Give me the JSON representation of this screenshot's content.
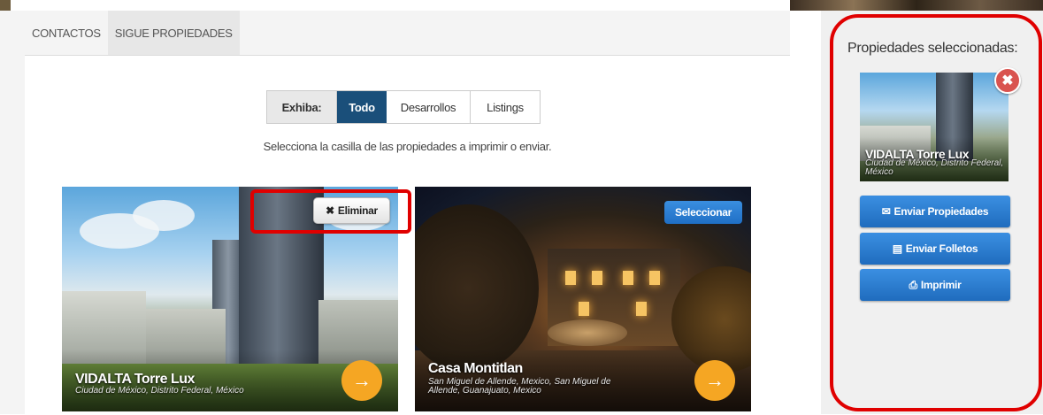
{
  "tabs": [
    {
      "label": "CONTACTOS"
    },
    {
      "label": "SIGUE PROPIEDADES"
    }
  ],
  "filter": {
    "label": "Exhiba:",
    "options": [
      {
        "label": "Todo",
        "selected": true
      },
      {
        "label": "Desarrollos",
        "selected": false
      },
      {
        "label": "Listings",
        "selected": false
      }
    ]
  },
  "instructions": "Selecciona la casilla de las propiedades a imprimir o enviar.",
  "properties": [
    {
      "title": "VIDALTA Torre Lux",
      "location": "Ciudad de México, Distrito Federal, México",
      "action_label": "Eliminar",
      "action_icon": "close-icon"
    },
    {
      "title": "Casa Montitlan",
      "location": "San Miguel de Allende, Mexico, San Miguel de Allende, Guanajuato, Mexico",
      "action_label": "Seleccionar"
    }
  ],
  "panel": {
    "title": "Propiedades seleccionadas:",
    "selected": {
      "title": "VIDALTA Torre Lux",
      "location": "Ciudad de México, Distrito Federal, México"
    },
    "buttons": [
      {
        "label": "Enviar Propiedades",
        "icon": "envelope-icon"
      },
      {
        "label": "Enviar Folletos",
        "icon": "document-icon"
      },
      {
        "label": "Imprimir",
        "icon": "printer-icon"
      }
    ]
  },
  "colors": {
    "accent": "#1a4f7a",
    "button_blue": "#2f7fd4",
    "orange": "#f5a623",
    "highlight_red": "#e00000",
    "remove_red": "#d9534f"
  }
}
